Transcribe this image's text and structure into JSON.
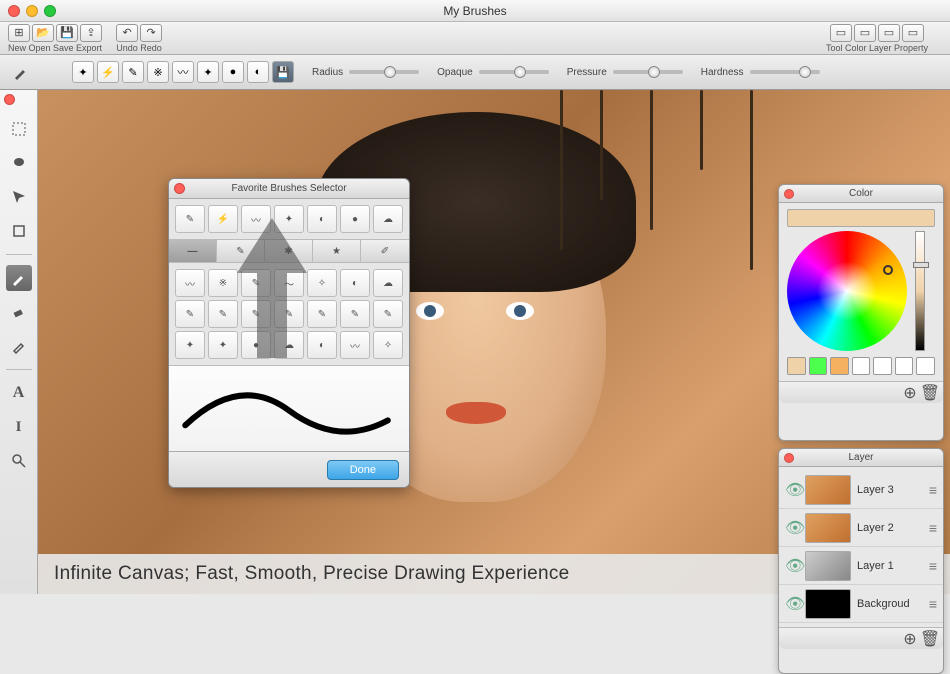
{
  "window": {
    "title": "My Brushes"
  },
  "toolbar": {
    "left_groups": [
      {
        "buttons": [
          "new-icon",
          "open-icon",
          "save-icon",
          "export-icon"
        ],
        "label": "New  Open  Save Export"
      },
      {
        "buttons": [
          "undo-icon",
          "redo-icon"
        ],
        "label": "Undo  Redo"
      }
    ],
    "right_group": {
      "buttons": [
        "tool-icon",
        "color-icon",
        "layer-icon",
        "property-icon"
      ],
      "label": "Tool  Color  Layer Property"
    }
  },
  "brushbar": {
    "slots": 8,
    "save_label": "💾"
  },
  "sliders": [
    {
      "label": "Radius"
    },
    {
      "label": "Opaque"
    },
    {
      "label": "Pressure"
    },
    {
      "label": "Hardness"
    }
  ],
  "tools": [
    "marquee-icon",
    "lasso-icon",
    "move-icon",
    "crop-icon",
    "brush-icon",
    "eraser-icon",
    "eyedropper-icon",
    "text-icon",
    "type-icon",
    "zoom-icon"
  ],
  "popup": {
    "title": "Favorite Brushes Selector",
    "fav_count": 7,
    "tab_count": 5,
    "grid_count": 21,
    "done": "Done"
  },
  "color_panel": {
    "title": "Color",
    "main_swatch": "#f0d2a8",
    "swatches": [
      "#f0d2a8",
      "#4cff4c",
      "#f5b060",
      "#ffffff",
      "#ffffff",
      "#ffffff",
      "#ffffff"
    ]
  },
  "layer_panel": {
    "title": "Layer",
    "layers": [
      {
        "name": "Layer 3",
        "visible": true,
        "thumb": "orange"
      },
      {
        "name": "Layer 2",
        "visible": true,
        "thumb": "orange"
      },
      {
        "name": "Layer 1",
        "visible": true,
        "thumb": "gray"
      },
      {
        "name": "Backgroud",
        "visible": true,
        "thumb": "black"
      }
    ]
  },
  "caption": "Infinite Canvas; Fast, Smooth, Precise Drawing Experience"
}
